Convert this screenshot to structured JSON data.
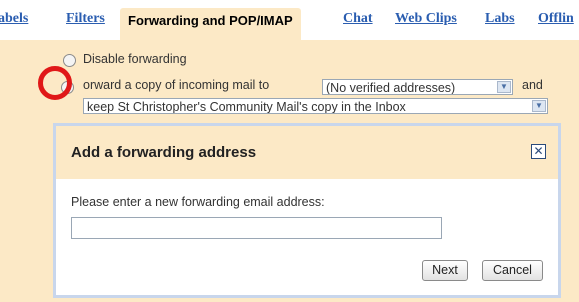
{
  "tabs": [
    {
      "label": "abels"
    },
    {
      "label": "Filters"
    },
    {
      "label": "Forwarding and POP/IMAP"
    },
    {
      "label": "Chat"
    },
    {
      "label": "Web Clips"
    },
    {
      "label": "Labs"
    },
    {
      "label": "Offlin"
    }
  ],
  "forwarding": {
    "disable_label": "Disable forwarding",
    "forward_label": "orward a copy of incoming mail to",
    "address_select": "(No verified addresses)",
    "and_label": "and",
    "action_select": "keep St Christopher's Community Mail's copy in the Inbox"
  },
  "dialog": {
    "title": "Add a forwarding address",
    "close_glyph": "✕",
    "prompt": "Please enter a new forwarding email address:",
    "input_value": "",
    "next_label": "Next",
    "cancel_label": "Cancel"
  },
  "colors": {
    "settings_bg": "#fce9c6",
    "link": "#2a5db0",
    "annotation_circle": "#e01818",
    "dialog_border": "#c8d6ec"
  },
  "icons": {
    "select_arrow": "chevron-down-icon",
    "close": "close-icon"
  }
}
